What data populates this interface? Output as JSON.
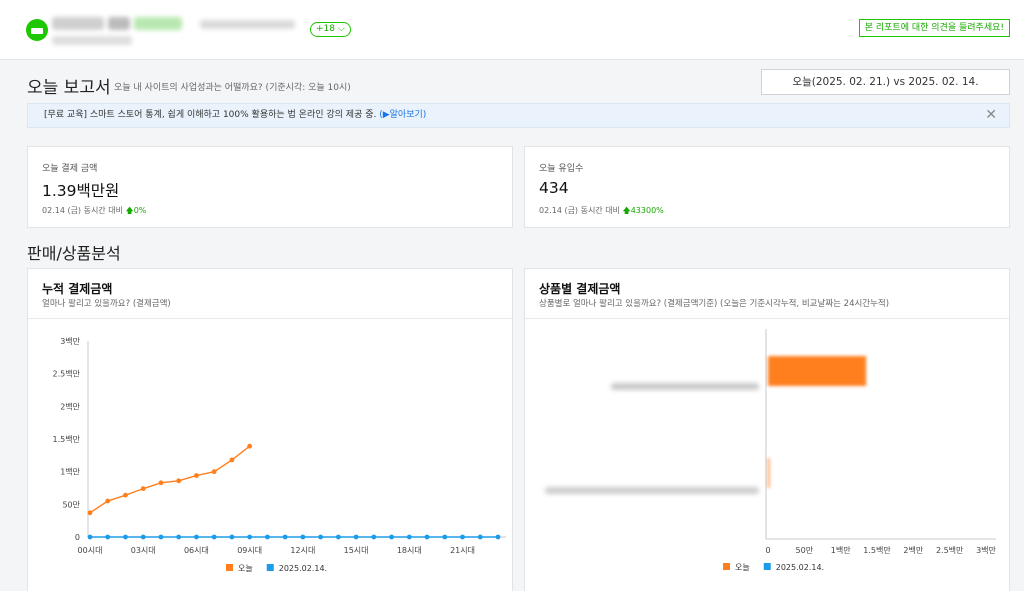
{
  "header": {
    "store_count_badge": "+18",
    "feedback_button": "본 리포트에 대한 의견을 들려주세요!"
  },
  "report": {
    "title": "오늘 보고서",
    "subtitle": "오늘 내 사이트의 사업성과는 어떨까요? (기준시각: 오늘 10시)",
    "date_range": "오늘(2025. 02. 21.) vs 2025. 02. 14."
  },
  "notice": {
    "text": "[무료 교육] 스마트 스토어 통계, 쉽게 이해하고 100% 활용하는 법 온라인 강의 제공 중. ",
    "link": "(▶알아보기)",
    "close": "✕"
  },
  "metrics": [
    {
      "label": "오늘 결제 금액",
      "value": "1.39백만원",
      "compare": "02.14 (금) 동시간 대비",
      "change": "0%"
    },
    {
      "label": "오늘 유입수",
      "value": "434",
      "compare": "02.14 (금) 동시간 대비",
      "change": "43300%"
    }
  ],
  "section": {
    "title": "판매/상품분석"
  },
  "cumulative_chart": {
    "title": "누적 결제금액",
    "subtitle": "얼마나 팔리고 있을까요? (결제금액)"
  },
  "product_chart": {
    "title": "상품별 결제금액",
    "subtitle": "상품별로 얼마나 팔리고 있을까요? (결제금액기준) (오늘은 기준시각누적, 비교날짜는 24시간누적)"
  },
  "colors": {
    "today": "#ff7f1e",
    "compare": "#1e9be8",
    "green": "#1ec800"
  },
  "chart_data": [
    {
      "type": "line",
      "x": [
        "00시대",
        "01시대",
        "02시대",
        "03시대",
        "04시대",
        "05시대",
        "06시대",
        "07시대",
        "08시대",
        "09시대",
        "10시대",
        "11시대",
        "12시대",
        "13시대",
        "14시대",
        "15시대",
        "16시대",
        "17시대",
        "18시대",
        "19시대",
        "20시대",
        "21시대",
        "22시대",
        "23시대"
      ],
      "x_tick_labels": [
        "00시대",
        "03시대",
        "06시대",
        "09시대",
        "12시대",
        "15시대",
        "18시대",
        "21시대"
      ],
      "y_tick_labels": [
        "0",
        "50만",
        "1백만",
        "1.5백만",
        "2백만",
        "2.5백만",
        "3백만"
      ],
      "ylim": [
        0,
        3000000
      ],
      "series": [
        {
          "name": "오늘",
          "color": "#ff7f1e",
          "values": [
            370000,
            550000,
            640000,
            740000,
            830000,
            860000,
            940000,
            1000000,
            1180000,
            1390000
          ]
        },
        {
          "name": "2025.02.14.",
          "color": "#1e9be8",
          "values": [
            0,
            0,
            0,
            0,
            0,
            0,
            0,
            0,
            0,
            0,
            0,
            0,
            0,
            0,
            0,
            0,
            0,
            0,
            0,
            0,
            0,
            0,
            0,
            0
          ]
        }
      ],
      "legend": "bottom"
    },
    {
      "type": "bar",
      "orientation": "horizontal",
      "x_tick_labels": [
        "0",
        "50만",
        "1백만",
        "1.5백만",
        "2백만",
        "2.5백만",
        "3백만"
      ],
      "xlim": [
        0,
        3000000
      ],
      "series": [
        {
          "name": "오늘",
          "color": "#ff7f1e",
          "values": [
            1350000,
            20000
          ]
        },
        {
          "name": "2025.02.14.",
          "color": "#1e9be8",
          "values": [
            0,
            0
          ]
        }
      ],
      "legend": "bottom"
    }
  ]
}
